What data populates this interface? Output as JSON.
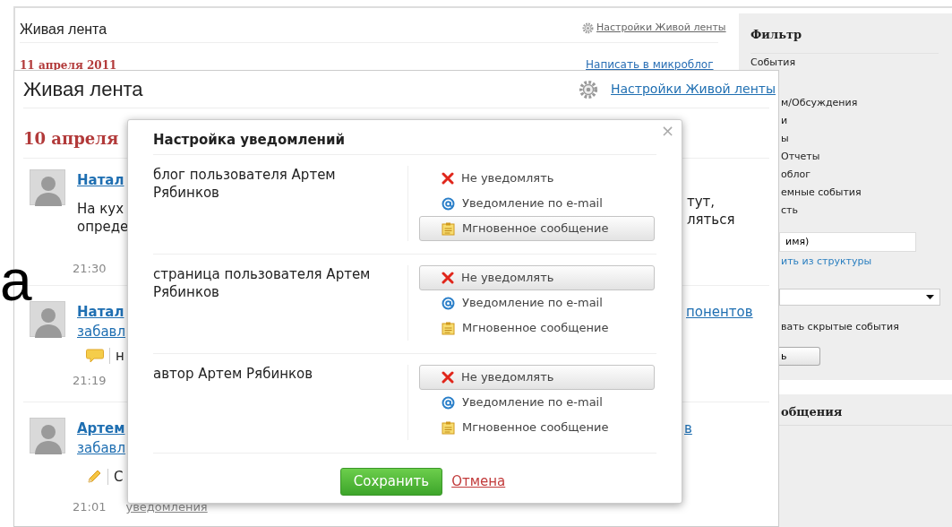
{
  "back_page": {
    "title": "Живая лента",
    "settings_link": "Настройки Живой ленты",
    "date": "11 апреля 2011",
    "microblog_link": "Написать в микроблог"
  },
  "filter": {
    "title": "Фильтр",
    "section_label": "События",
    "items": [
      "м/Обсуждения",
      "и",
      "ы",
      "Отчеты",
      "облог",
      "емные события",
      "сть"
    ],
    "name_field": {
      "value": "имя)"
    },
    "structure_link": "ить из структуры",
    "hidden_events_label": "вать скрытые события",
    "apply_button": "ь",
    "messages_heading": "общения"
  },
  "edge_fragment": "а",
  "feed_panel": {
    "title": "Живая лента",
    "settings_link": "Настройки Живой ленты",
    "date": "10 апреля",
    "entries": [
      {
        "kind": "post",
        "author": "Натал",
        "text_lines": [
          "На кух",
          "опреде"
        ],
        "right_fragments": [
          "тут,",
          "ляться"
        ],
        "time": "21:30"
      },
      {
        "kind": "comment",
        "author": "Натал",
        "link": "забавл",
        "right_link": "понентов",
        "snippet": "н",
        "time": "21:19"
      },
      {
        "kind": "edit",
        "author": "Артем",
        "link": "забавл",
        "right_link": "в",
        "snippet": "С",
        "time": "21:01",
        "footer_link": "уведомления"
      }
    ]
  },
  "dialog": {
    "title": "Настройка уведомлений",
    "close_symbol": "×",
    "sections": [
      {
        "label": "блог пользователя Артем Рябинков",
        "options": [
          {
            "kind": "none",
            "text": "Не уведомлять",
            "selected": false
          },
          {
            "kind": "email",
            "text": "Уведомление по e-mail",
            "selected": false
          },
          {
            "kind": "im",
            "text": "Мгновенное сообщение",
            "selected": true
          }
        ]
      },
      {
        "label": "страница пользователя Артем Рябинков",
        "options": [
          {
            "kind": "none",
            "text": "Не уведомлять",
            "selected": true
          },
          {
            "kind": "email",
            "text": "Уведомление по e-mail",
            "selected": false
          },
          {
            "kind": "im",
            "text": "Мгновенное сообщение",
            "selected": false
          }
        ]
      },
      {
        "label": "автор Артем Рябинков",
        "options": [
          {
            "kind": "none",
            "text": "Не уведомлять",
            "selected": true
          },
          {
            "kind": "email",
            "text": "Уведомление по e-mail",
            "selected": false
          },
          {
            "kind": "im",
            "text": "Мгновенное сообщение",
            "selected": false
          }
        ]
      }
    ],
    "save_button": "Сохранить",
    "cancel_link": "Отмена"
  }
}
